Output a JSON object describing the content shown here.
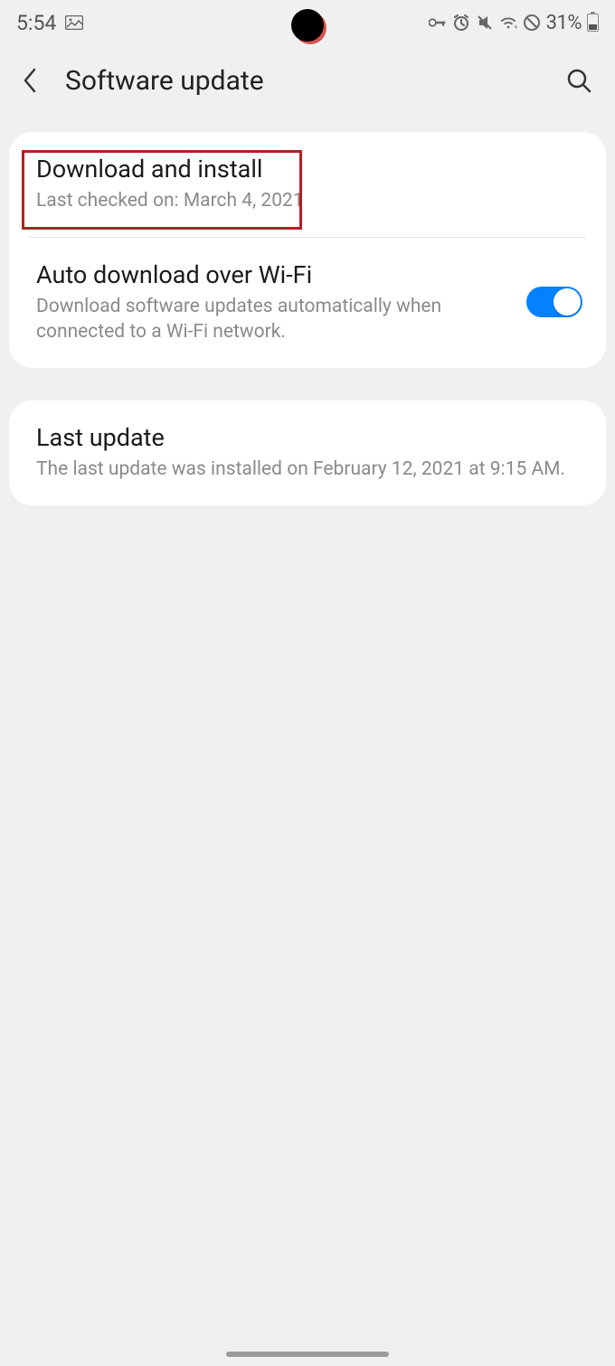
{
  "statusBar": {
    "time": "5:54",
    "batteryPct": "31%"
  },
  "header": {
    "title": "Software update"
  },
  "card1": {
    "download": {
      "title": "Download and install",
      "sub": "Last checked on: March 4, 2021"
    },
    "autoDownload": {
      "title": "Auto download over Wi-Fi",
      "sub": "Download software updates automatically when connected to a Wi-Fi network."
    }
  },
  "card2": {
    "lastUpdate": {
      "title": "Last update",
      "sub": "The last update was installed on February 12, 2021 at 9:15 AM."
    }
  }
}
